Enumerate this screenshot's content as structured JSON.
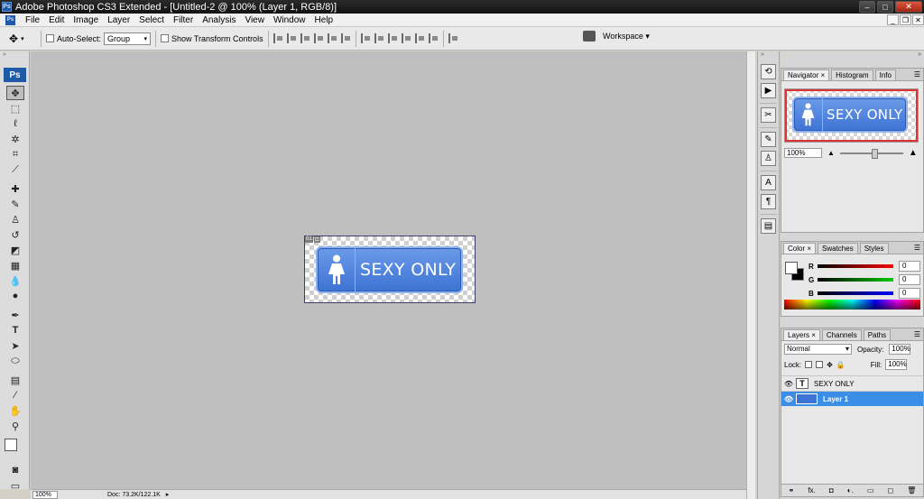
{
  "window": {
    "title": "Adobe Photoshop CS3 Extended - [Untitled-2 @ 100% (Layer 1, RGB/8)]",
    "app_badge": "Ps",
    "doc_badge": "Ps",
    "btn_min": "–",
    "btn_max": "□",
    "btn_close": "✕"
  },
  "menu": [
    "File",
    "Edit",
    "Image",
    "Layer",
    "Select",
    "Filter",
    "Analysis",
    "View",
    "Window",
    "Help"
  ],
  "mdi": {
    "min": "_",
    "restore": "❐",
    "close": "✕"
  },
  "options": {
    "auto_select_label": "Auto-Select:",
    "auto_select_value": "Group",
    "show_transform_label": "Show Transform Controls",
    "workspace_label": "Workspace ▾"
  },
  "toolbar": {
    "logo": "Ps",
    "grip": "»"
  },
  "canvas": {
    "slice_tags": [
      "01",
      "⊡"
    ],
    "sign_text": "SEXY ONLY"
  },
  "status": {
    "zoom": "100%",
    "doc_size": "Doc: 73.2K/122.1K",
    "arrow": "▸"
  },
  "dock": {
    "grip": "»"
  },
  "navigator": {
    "tabs": [
      "Navigator ×",
      "Histogram",
      "Info"
    ],
    "zoom": "100%",
    "sign_text": "SEXY ONLY"
  },
  "color": {
    "tabs": [
      "Color ×",
      "Swatches",
      "Styles"
    ],
    "channels": [
      {
        "label": "R",
        "value": "0",
        "color": "#ff0000"
      },
      {
        "label": "G",
        "value": "0",
        "color": "#00b000"
      },
      {
        "label": "B",
        "value": "0",
        "color": "#0000ff"
      }
    ]
  },
  "layers": {
    "tabs": [
      "Layers ×",
      "Channels",
      "Paths"
    ],
    "blend_mode": "Normal",
    "opacity_label": "Opacity:",
    "opacity_value": "100%",
    "lock_label": "Lock:",
    "fill_label": "Fill:",
    "fill_value": "100%",
    "items": [
      {
        "name": "SEXY ONLY",
        "thumb": "T",
        "selected": false
      },
      {
        "name": "Layer 1",
        "thumb": "",
        "selected": true
      }
    ],
    "footer_icons": [
      "⚭",
      "fx.",
      "◘",
      "◐.",
      "▭",
      "◻",
      "🗑"
    ]
  },
  "colors": {
    "accent": "#3a8ee6",
    "sign": "#3d73d4",
    "nav_box": "#dd3333"
  }
}
